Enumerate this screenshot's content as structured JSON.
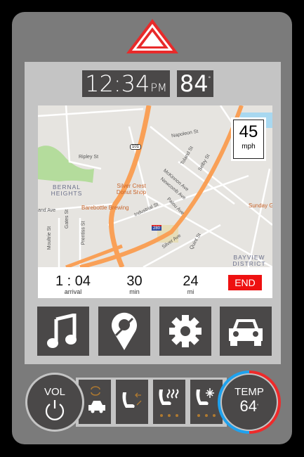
{
  "header": {
    "time": "12:34",
    "ampm": "PM",
    "outside_temp": "84",
    "degree": "°"
  },
  "map": {
    "speed_limit": "45",
    "speed_unit": "mph",
    "labels": {
      "napoleon": "Napoleon St",
      "toland": "Toland St",
      "selby": "Selby St",
      "mckinnon": "McKinnon Ave",
      "newcomb": "Newcomb Ave",
      "palou": "Palou Ave",
      "ripley": "Ripley St",
      "industrial": "Industrial St",
      "silver": "Silver Ave",
      "quint": "Quint St",
      "gates": "Gates St",
      "prentiss": "Prentiss St",
      "moultrie": "Moultrie St",
      "cortland": "and Ave",
      "bernal": "BERNAL HEIGHTS",
      "bayview": "BAYVIEW DISTRICT",
      "silvercrest": "Silver Crest Donut Shop",
      "barebottle": "Barebottle Brewing",
      "sunday": "Sunday Ga",
      "hwy101": "101",
      "i280": "280"
    }
  },
  "trip": {
    "arrival": "1 : 04",
    "arrival_label": "arrival",
    "duration": "30",
    "duration_label": "min",
    "distance": "24",
    "distance_label": "mi",
    "end_label": "END"
  },
  "apps": [
    "music",
    "navigation",
    "settings",
    "vehicle"
  ],
  "controls": {
    "vol_label": "VOL",
    "temp_label": "TEMP",
    "temp_value": "64",
    "degree": "°"
  },
  "colors": {
    "hazard": "#e82a2a",
    "end": "#ee1111",
    "temp_cold": "#1fa2ee",
    "temp_hot": "#ee2a2a",
    "route": "#f9a057",
    "seat_dots": "#b07a30"
  }
}
